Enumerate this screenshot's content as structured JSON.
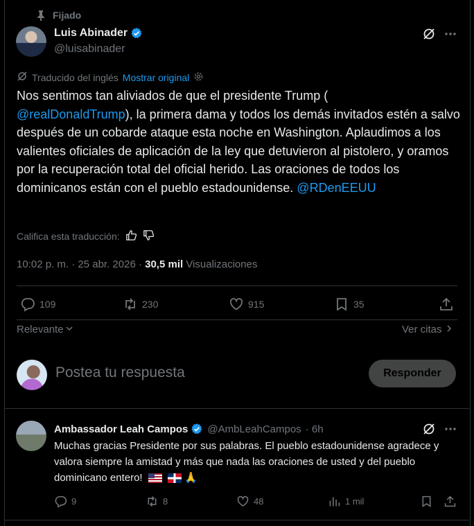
{
  "pinned_label": "Fijado",
  "author": {
    "name": "Luis Abinader",
    "handle": "@luisabinader"
  },
  "translation": {
    "note": "Traducido del inglés",
    "show_original": "Mostrar original"
  },
  "tweet": {
    "text_before": "Nos sentimos tan aliviados de que el presidente Trump (",
    "mention1": "@realDonaldTrump",
    "text_after": "), la primera dama y todos los demás invitados estén a salvo después de un cobarde ataque esta noche en Washington. Aplaudimos a los valientes oficiales de aplicación de la ley que detuvieron al pistolero, y oramos por la recuperación total del oficial herido. Las oraciones de todos los dominicanos están con el pueblo estadounidense. ",
    "mention2": "@RDenEEUU"
  },
  "rate_label": "Califica esta traducción:",
  "meta": {
    "time": "10:02 p. m. · 25 abr. 2026 · ",
    "views_count": "30,5 mil",
    "views_label": " Visualizaciones"
  },
  "actions": {
    "replies": "109",
    "reposts": "230",
    "likes": "915",
    "bookmarks": "35"
  },
  "sort": {
    "label": "Relevante",
    "quotes_label": "Ver citas"
  },
  "composer": {
    "placeholder": "Postea tu respuesta",
    "button": "Responder"
  },
  "reply": {
    "name": "Ambassador Leah Campos",
    "handle": "@AmbLeahCampos",
    "time": "· 6h",
    "text": "Muchas gracias Presidente por sus palabras.  El pueblo estadounidense agradece y valora siempre la amistad y más que nada las oraciones de usted y del pueblo dominicano entero!",
    "emoji": "🙏",
    "actions": {
      "replies": "9",
      "reposts": "8",
      "likes": "48",
      "views": "1 mil"
    }
  },
  "colors": {
    "background": "#000000",
    "text": "#e7e9ea",
    "muted": "#71767b",
    "accent": "#1d9bf0",
    "verified": "#1d9bf0",
    "divider": "#2f3336"
  }
}
